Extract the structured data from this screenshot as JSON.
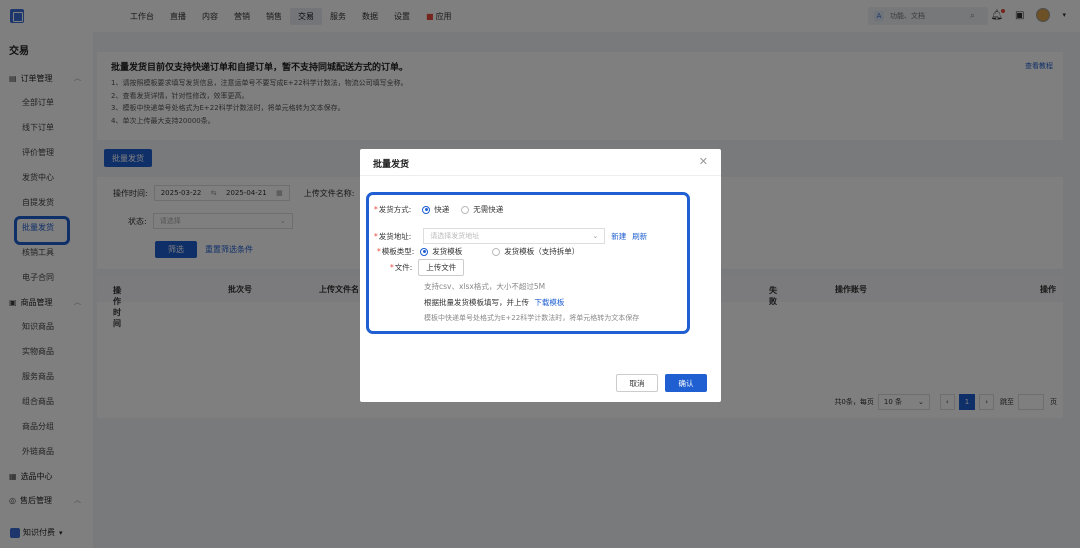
{
  "topnav": {
    "items": [
      "工作台",
      "直播",
      "内容",
      "营销",
      "销售",
      "交易",
      "服务",
      "数据",
      "设置"
    ],
    "app_label": "应用",
    "active": "交易"
  },
  "search": {
    "tag": "A",
    "placeholder": "功能、文档"
  },
  "sidebar": {
    "title": "交易",
    "group_orders": "订单管理",
    "order_items": [
      "全部订单",
      "线下订单",
      "评价管理",
      "发货中心",
      "自提发货",
      "批量发货",
      "核销工具",
      "电子合同"
    ],
    "group_goods": "商品管理",
    "goods_items": [
      "知识商品",
      "实物商品",
      "服务商品",
      "组合商品",
      "商品分组",
      "外链商品"
    ],
    "group_select": "选品中心",
    "group_aftersale": "售后管理",
    "bottom_label": "知识付费"
  },
  "notice": {
    "title": "批量发货目前仅支持快递订单和自提订单，暂不支持同城配送方式的订单。",
    "lines": [
      "1、请按照模板要求填写发货信息，注意运单号不要写成E+22科学计数法，物流公司填写全称。",
      "2、查看发货详情，针对性修改，效率更高。",
      "3、模板中快递单号处格式为E+22科学计数法时，将单元格转为文本保存。",
      "4、单次上传最大支持20000条。"
    ],
    "tutorial": "查看教程"
  },
  "batch_button": "批量发货",
  "filter": {
    "time_label": "操作时间:",
    "start_date": "2025-03-22",
    "end_date": "2025-04-21",
    "file_label": "上传文件名称:",
    "status_label": "状态:",
    "status_placeholder": "请选择",
    "filter_button": "筛选",
    "reset_link": "重置筛选条件"
  },
  "table": {
    "headers": [
      "操作时间",
      "批次号",
      "上传文件名",
      "失败",
      "操作账号",
      "操作"
    ]
  },
  "pager": {
    "total": "共0条，每页",
    "page_size": "10 条",
    "current": "1",
    "jump_label": "跳至",
    "page_unit": "页"
  },
  "modal": {
    "title": "批量发货",
    "method_label": "发货方式:",
    "method_options": [
      "快递",
      "无需快递"
    ],
    "address_label": "发货地址:",
    "address_placeholder": "请选择发货地址",
    "new_link": "新建",
    "refresh_link": "刷新",
    "template_label": "模板类型:",
    "template_options": [
      "发货模板",
      "发货模板（支持拆单）"
    ],
    "file_label": "文件:",
    "upload_button": "上传文件",
    "hint_formats": "支持csv、xlsx格式，大小不超过5M",
    "hint_fill": "根据批量发货模板填写，并上传",
    "download_link": "下载模板",
    "hint_format_note": "模板中快递单号处格式为E+22科学计数法时，将单元格转为文本保存",
    "cancel_button": "取消",
    "confirm_button": "确认"
  }
}
